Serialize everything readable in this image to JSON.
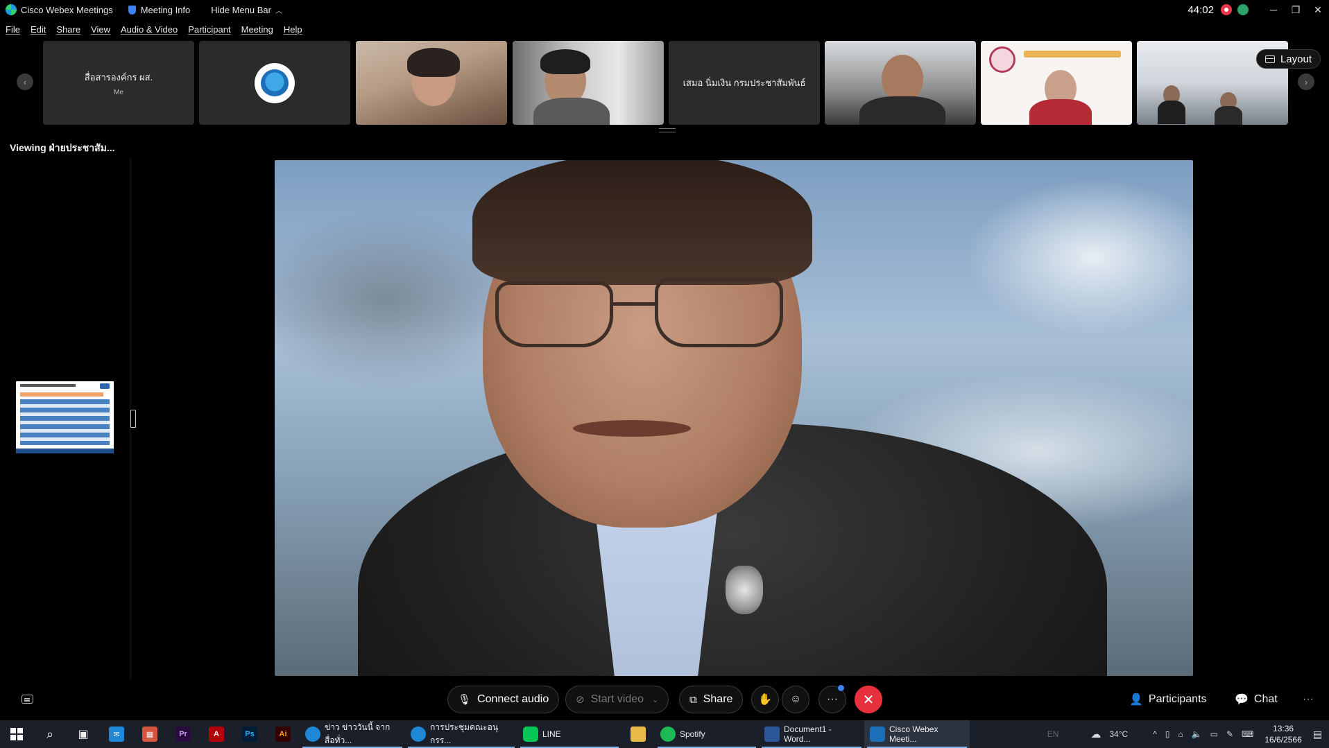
{
  "titlebar": {
    "app_title": "Cisco Webex Meetings",
    "meeting_info": "Meeting Info",
    "hide_menu": "Hide Menu Bar",
    "timer": "44:02"
  },
  "menu": [
    "File",
    "Edit",
    "Share",
    "View",
    "Audio & Video",
    "Participant",
    "Meeting",
    "Help"
  ],
  "filmstrip": {
    "layout_label": "Layout",
    "tiles": [
      {
        "name": "สื่อสารองค์กร ผส.",
        "sub": "Me"
      },
      {
        "name": "เสมอ นิ่มเงิน กรมประชาสัมพันธ์"
      }
    ]
  },
  "viewing_label": "Viewing ฝ่ายประชาสัม...",
  "controls": {
    "connect_audio": "Connect audio",
    "start_video": "Start video",
    "share": "Share",
    "participants": "Participants",
    "chat": "Chat"
  },
  "taskbar": {
    "apps": [
      {
        "label": "ข่าว ข่าววันนี้ จากสื่อทั่ว...",
        "color": "#1e88d6"
      },
      {
        "label": "การประชุมคณะอนุกรร...",
        "color": "#1e88d6"
      },
      {
        "label": "LINE",
        "color": "#06c755"
      },
      {
        "label": "Spotify",
        "color": "#1db954"
      },
      {
        "label": "Document1 - Word...",
        "color": "#2b579a"
      },
      {
        "label": "Cisco Webex Meeti...",
        "color": "#1b6fb8"
      }
    ],
    "lang": "EN",
    "weather": "34°C",
    "time": "13:36",
    "date": "16/6/2566"
  },
  "colors": {
    "end_call": "#e6313d",
    "record": "#e8374a",
    "accent": "#3b82f6"
  }
}
